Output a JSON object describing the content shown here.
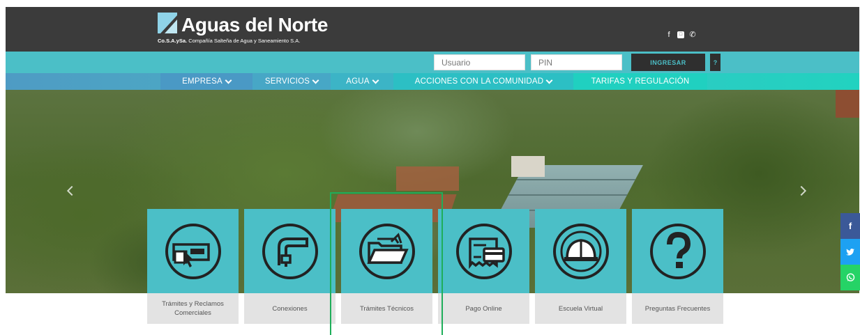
{
  "header": {
    "brand_name": "Aguas del Norte",
    "tagline_bold": "Co.S.A.ySa.",
    "tagline": "Compañía Salteña de Agua y Saneamiento S.A.",
    "social_icons": [
      "facebook-icon",
      "instagram-icon",
      "whatsapp-icon"
    ],
    "social_glyphs": {
      "facebook": "f",
      "instagram": "◘",
      "whatsapp": "✆"
    }
  },
  "login": {
    "user_placeholder": "Usuario",
    "pin_placeholder": "PIN",
    "submit_label": "INGRESAR",
    "help_label": "?"
  },
  "nav": {
    "items": [
      {
        "label": "EMPRESA",
        "has_dropdown": true
      },
      {
        "label": "SERVICIOS",
        "has_dropdown": true
      },
      {
        "label": "AGUA",
        "has_dropdown": true
      },
      {
        "label": "ACCIONES CON LA COMUNIDAD",
        "has_dropdown": true
      },
      {
        "label": "TARIFAS Y REGULACIÓN",
        "has_dropdown": false
      }
    ]
  },
  "services": [
    {
      "label": "Trámites y Reclamos Comerciales",
      "icon": "form-click-icon"
    },
    {
      "label": "Conexiones",
      "icon": "faucet-icon"
    },
    {
      "label": "Trámites Técnicos",
      "icon": "folder-icon"
    },
    {
      "label": "Pago Online",
      "icon": "payment-card-icon"
    },
    {
      "label": "Escuela Virtual",
      "icon": "hard-hat-icon"
    },
    {
      "label": "Preguntas Frecuentes",
      "icon": "question-icon"
    }
  ],
  "side_social": {
    "facebook": "f",
    "twitter": "🐦",
    "whatsapp": "✆"
  },
  "colors": {
    "header_bg": "#3b3b3b",
    "accent_teal": "#4bbfc7",
    "nav_start": "#4a99c5",
    "nav_end": "#20d0c0",
    "button_dark": "#2f2f2f",
    "caption_bg": "#e3e3e3",
    "highlight_green": "#1fae5a",
    "facebook": "#3b5998",
    "twitter": "#1da1f2",
    "whatsapp": "#25d366"
  }
}
